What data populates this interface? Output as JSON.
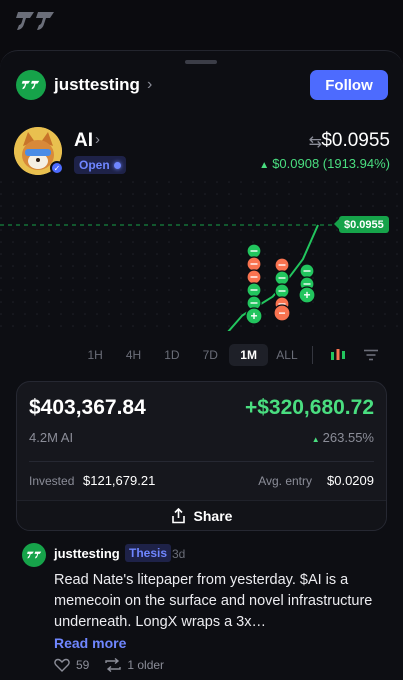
{
  "creator": {
    "name": "justtesting",
    "follow_label": "Follow"
  },
  "token": {
    "name": "AI",
    "status": "Open",
    "price": "$0.0955",
    "change": "$0.0908 (1913.94%)"
  },
  "chart": {
    "price_tag": "$0.0955",
    "ranges": [
      "1H",
      "4H",
      "1D",
      "7D",
      "1M",
      "ALL"
    ],
    "active_range": "1M"
  },
  "chart_data": {
    "type": "line",
    "series": [
      {
        "values": [
          0.0047,
          0.0047,
          0.0048,
          0.0048,
          0.0049,
          0.005,
          0.005,
          0.0052,
          0.0055,
          0.0058,
          0.006,
          0.0062,
          0.0065,
          0.0075,
          0.009,
          0.015,
          0.028,
          0.035,
          0.042,
          0.055,
          0.07,
          0.0955
        ]
      }
    ],
    "current_price": 0.0955,
    "trade_markers": {
      "columns": [
        {
          "buys": 4,
          "sells": 0
        },
        {
          "buys": 1,
          "sells": 4
        },
        {
          "buys": 3,
          "sells": 2
        },
        {
          "buys": 1,
          "sells": 3
        },
        {
          "buys": 3,
          "sells": 1
        }
      ]
    }
  },
  "position": {
    "value": "$403,367.84",
    "pnl": "+$320,680.72",
    "holdings": "4.2M AI",
    "pnl_pct": "263.55%",
    "invested_label": "Invested",
    "invested": "$121,679.21",
    "avg_label": "Avg. entry",
    "avg_entry": "$0.0209",
    "share_label": "Share"
  },
  "post": {
    "author": "justtesting",
    "tag": "Thesis",
    "age": "3d",
    "body": "Read Nate's litepaper from yesterday. $AI is a memecoin on the surface and novel infrastructure underneath. LongX wraps a 3x…",
    "read_more": "Read more",
    "likes": "59",
    "reposts": "1 older"
  },
  "colors": {
    "accent": "#4d6bfe",
    "positive": "#4ade80",
    "buy": "#22c55e",
    "sell": "#f97350"
  }
}
